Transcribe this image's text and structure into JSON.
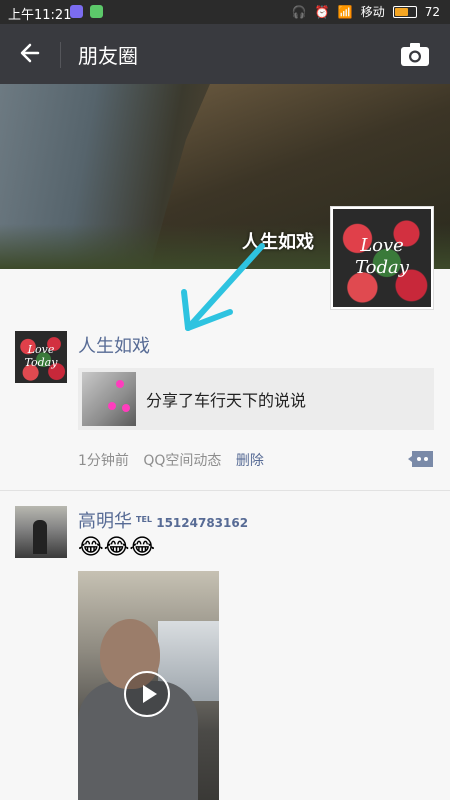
{
  "status": {
    "time": "上午11:21",
    "carrier": "移动",
    "battery": "72",
    "battery_level": 0.72
  },
  "header": {
    "title": "朋友圈"
  },
  "cover": {
    "name": "人生如戏",
    "avatar_text_1": "Love",
    "avatar_text_2": "Today"
  },
  "posts": [
    {
      "name": "人生如戏",
      "avatar_text_1": "Love",
      "avatar_text_2": "Today",
      "share_text": "分享了车行天下的说说",
      "time_ago": "1分钟前",
      "source": "QQ空间动态",
      "delete_label": "删除"
    },
    {
      "name": "高明华",
      "phone_prefix": "TEL",
      "phone": "15124783162",
      "emoji": "😂😂😂"
    }
  ],
  "colors": {
    "link": "#576b95",
    "topbar": "#393a3f",
    "statusbar": "#2b2b2b"
  }
}
